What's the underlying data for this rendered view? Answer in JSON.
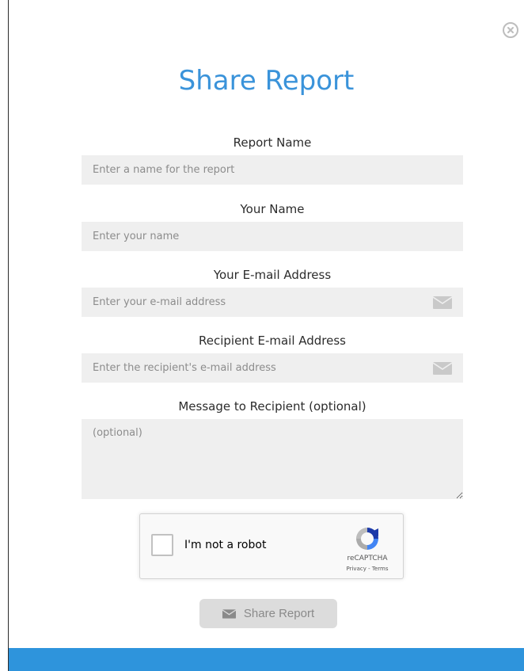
{
  "dialog": {
    "title": "Share Report",
    "fields": [
      {
        "label": "Report Name",
        "placeholder": "Enter a name for the report",
        "value": ""
      },
      {
        "label": "Your Name",
        "placeholder": "Enter your name",
        "value": ""
      },
      {
        "label": "Your E-mail Address",
        "placeholder": "Enter your e-mail address",
        "value": "",
        "icon": "envelope-icon"
      },
      {
        "label": "Recipient E-mail Address",
        "placeholder": "Enter the recipient's e-mail address",
        "value": "",
        "icon": "envelope-icon"
      },
      {
        "label": "Message to Recipient (optional)",
        "placeholder": "(optional)",
        "value": ""
      }
    ],
    "close_icon": "close-circle-icon"
  },
  "recaptcha": {
    "label": "I'm not a robot",
    "brand": "reCAPTCHA",
    "privacy": "Privacy",
    "separator": " - ",
    "terms": "Terms",
    "checked": false
  },
  "share_button": {
    "label": "Share Report",
    "icon": "envelope-icon",
    "enabled": false
  },
  "colors": {
    "title": "#3a93da",
    "footer_bar": "#2e94dc",
    "field_bg": "#efefef",
    "button_bg": "#dcdcdc"
  }
}
